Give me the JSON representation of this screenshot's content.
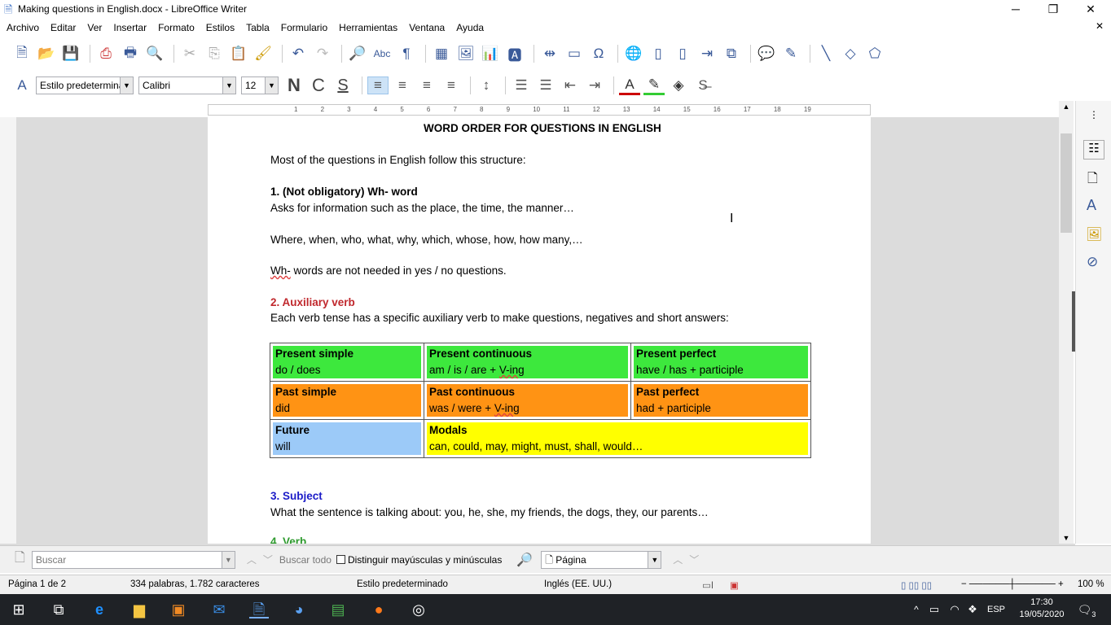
{
  "window": {
    "title": "Making questions in English.docx - LibreOffice Writer"
  },
  "menu": [
    "Archivo",
    "Editar",
    "Ver",
    "Insertar",
    "Formato",
    "Estilos",
    "Tabla",
    "Formulario",
    "Herramientas",
    "Ventana",
    "Ayuda"
  ],
  "format_toolbar": {
    "paragraph_style": "Estilo predetermina",
    "font_name": "Calibri",
    "font_size": "12",
    "bold": "N",
    "italic": "C",
    "underline": "S"
  },
  "ruler_labels": [
    "1",
    "1",
    "2",
    "3",
    "4",
    "5",
    "6",
    "7",
    "8",
    "9",
    "10",
    "11",
    "12",
    "13",
    "14",
    "15",
    "16",
    "17",
    "18",
    "19"
  ],
  "document": {
    "title": "WORD ORDER FOR QUESTIONS IN ENGLISH",
    "intro": "Most of the questions in English follow this structure:",
    "s1_heading": "1. (Not obligatory) Wh- word",
    "s1_text": "Asks for information such as the place, the time, the manner…",
    "s1_examples": "Where, when, who, what, why, which, whose, how, how many,…",
    "s1_note_prefix": "Wh-",
    "s1_note": " words are not needed in yes / no questions.",
    "s2_heading": "2. Auxiliary verb",
    "s2_text": "Each verb tense has a specific auxiliary verb to make questions, negatives and short answers:",
    "table": [
      [
        {
          "title": "Present simple",
          "value": "do / does",
          "color": "#3de83d"
        },
        {
          "title": "Present continuous",
          "value": "am / is / are  + V-ing",
          "color": "#3de83d"
        },
        {
          "title": "Present perfect",
          "value": "have / has + participle",
          "color": "#3de83d"
        }
      ],
      [
        {
          "title": "Past simple",
          "value": "did",
          "color": "#ff9314"
        },
        {
          "title": "Past continuous",
          "value": "was / were + V-ing",
          "color": "#ff9314"
        },
        {
          "title": "Past perfect",
          "value": "had  + participle",
          "color": "#ff9314"
        }
      ],
      [
        {
          "title": "Future",
          "value": "will",
          "color": "#9ccaf8"
        },
        {
          "title": "Modals",
          "value": "can, could, may, might, must, shall, would…",
          "color": "#ffff00"
        }
      ]
    ],
    "s3_heading": "3. Subject",
    "s3_text": "What the sentence is talking about: you, he, she, my friends, the dogs, they, our parents…",
    "s4_heading_partial": "4. Verb",
    "colors": {
      "s2_heading": "#c0282d",
      "s3_heading": "#1c1cc8",
      "s4_heading": "#2e9a2e"
    }
  },
  "findbar": {
    "search_placeholder": "Buscar",
    "find_all": "Buscar todo",
    "match_case": "Distinguir mayúsculas y minúsculas",
    "navigate_by": "Página"
  },
  "statusbar": {
    "page": "Página 1 de 2",
    "counts": "334 palabras, 1.782 caracteres",
    "style": "Estilo predeterminado",
    "language": "Inglés (EE. UU.)",
    "zoom": "100 %"
  },
  "taskbar": {
    "lang": "ESP",
    "time": "17:30",
    "date": "19/05/2020",
    "notifications": "3"
  }
}
